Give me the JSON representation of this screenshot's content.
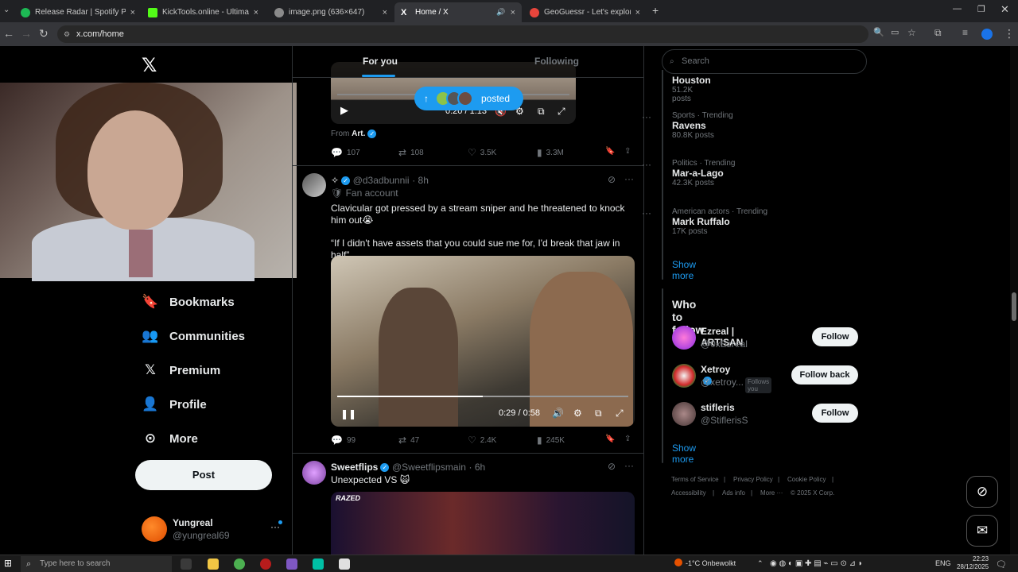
{
  "browser": {
    "tabs": [
      {
        "title": "Release Radar | Spotify Playlist",
        "color": "#1db954"
      },
      {
        "title": "KickTools.online - Ultimate Kick",
        "color": "#53fc18"
      },
      {
        "title": "image.png (636×647)",
        "color": "#8a8a8a"
      },
      {
        "title": "Home / X",
        "color": "#ffffff"
      },
      {
        "title": "GeoGuessr - Let's explore the w",
        "color": "#e8453c"
      }
    ],
    "close": "×",
    "new_tab": "+",
    "url": "x.com/home"
  },
  "sidebar": {
    "items": [
      {
        "label": "Bookmarks",
        "icon": "bookmark-icon",
        "glyph": "🔖"
      },
      {
        "label": "Communities",
        "icon": "communities-icon",
        "glyph": "👥"
      },
      {
        "label": "Premium",
        "icon": "x-premium-icon",
        "glyph": "𝕏"
      },
      {
        "label": "Profile",
        "icon": "profile-icon",
        "glyph": "👤"
      },
      {
        "label": "More",
        "icon": "more-circle-icon",
        "glyph": "⋯"
      }
    ],
    "post_label": "Post",
    "account": {
      "name": "Yungreal",
      "handle": "@yungreal69"
    }
  },
  "feed": {
    "tabs": [
      "For you",
      "Following"
    ],
    "posted_pill": "posted",
    "post1": {
      "video_time": "0:20 / 1:13",
      "from_label": "From",
      "from_name": "Art.",
      "replies": "107",
      "reposts": "108",
      "likes": "3.5K",
      "views": "3.3M"
    },
    "post2": {
      "name_prefix": "✧",
      "handle": "@d3adbunnii",
      "time": "· 8h",
      "subline": "Fan account",
      "text1": "Clavicular got pressed by a stream sniper and he threatened to knock him out😭",
      "text2": "“If I didn't have assets that you could sue me for, I'd break that jaw in half”",
      "video_time": "0:29 / 0:58",
      "replies": "99",
      "reposts": "47",
      "likes": "2.4K",
      "views": "245K"
    },
    "post3": {
      "name": "Sweetflips",
      "handle": "@Sweetflipsmain",
      "time": "· 6h",
      "text": "Unexpected VS 🙀",
      "brand": "RAZED"
    }
  },
  "right": {
    "search_placeholder": "Search",
    "trends": [
      {
        "meta": "",
        "name": "Houston",
        "count": "51.2K posts"
      },
      {
        "meta": "Sports · Trending",
        "name": "Ravens",
        "count": "80.8K posts"
      },
      {
        "meta": "Politics · Trending",
        "name": "Mar-a-Lago",
        "count": "42.3K posts"
      },
      {
        "meta": "American actors · Trending",
        "name": "Mark Ruffalo",
        "count": "17K posts"
      }
    ],
    "show_more": "Show more",
    "who_title": "Who to follow",
    "who": [
      {
        "name": "Ezreal | ARTISAN",
        "handle": "@0xEzreal",
        "button": "Follow",
        "follows_you": ""
      },
      {
        "name": "Xetroy",
        "handle": "@xetroy...",
        "button": "Follow back",
        "follows_you": "Follows you"
      },
      {
        "name": "stifleris",
        "handle": "@StiflerisS",
        "button": "Follow",
        "follows_you": ""
      }
    ],
    "who_show_more": "Show more",
    "footer": [
      "Terms of Service",
      "|",
      "Privacy Policy",
      "|",
      "Cookie Policy",
      "|",
      "Accessibility",
      "|",
      "Ads info",
      "|",
      "More ···",
      "© 2025 X Corp."
    ]
  },
  "taskbar": {
    "search_placeholder": "Type here to search",
    "weather": "-1°C  Onbewolkt",
    "lang": "ENG",
    "time": "22:23",
    "date": "28/12/2025"
  }
}
